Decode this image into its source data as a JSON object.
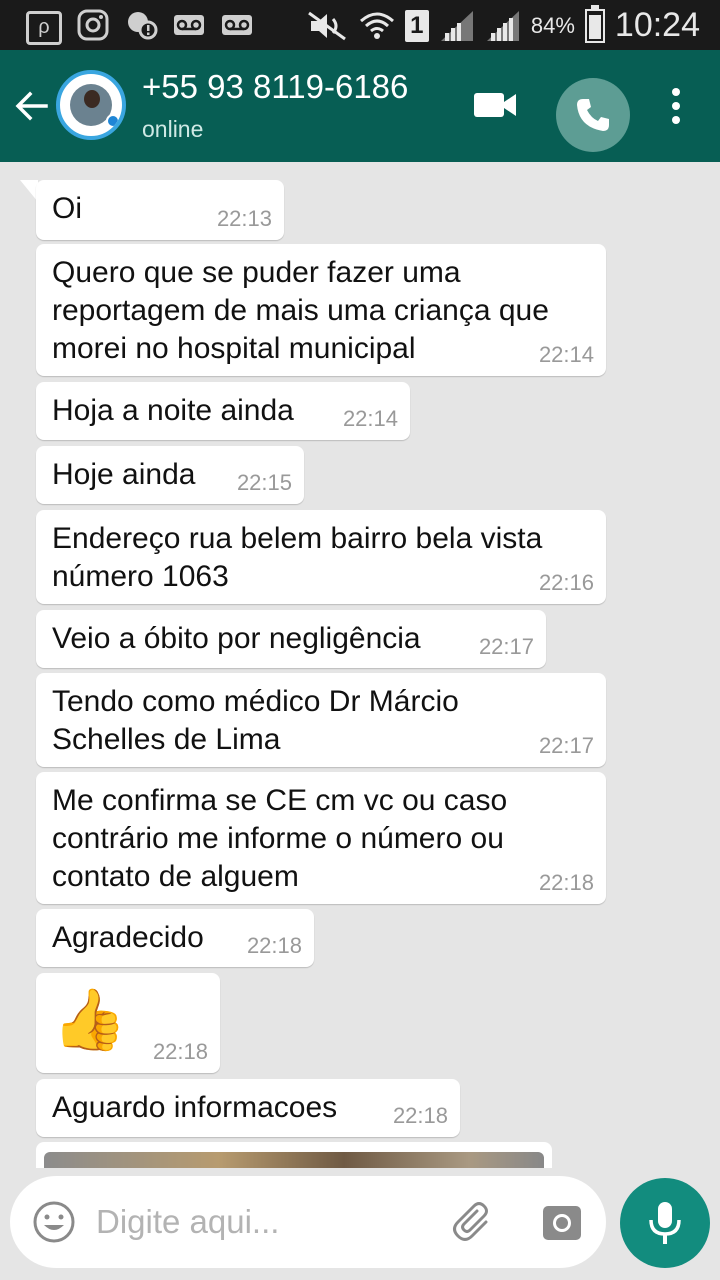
{
  "status_bar": {
    "battery": "84%",
    "time": "10:24",
    "sim_slot": "1",
    "left_icons": [
      "quick-app-icon",
      "instagram-icon",
      "notification-icon",
      "voicemail-icon",
      "voicemail-icon"
    ]
  },
  "header": {
    "contact_name": "+55 93 8119-6186",
    "status": "online",
    "color": "#075e54"
  },
  "messages": [
    {
      "text": "Oi",
      "time": "22:13"
    },
    {
      "text": "Quero que se puder fazer uma\nreportagem de mais uma criança que\nmorei no hospital municipal",
      "time": "22:14"
    },
    {
      "text": "Hoja a noite ainda",
      "time": "22:14"
    },
    {
      "text": "Hoje ainda",
      "time": "22:15"
    },
    {
      "text": "Endereço rua belem bairro bela vista\nnúmero 1063",
      "time": "22:16"
    },
    {
      "text": "Veio a óbito por negligência",
      "time": "22:17"
    },
    {
      "text": "Tendo como médico Dr Márcio\nSchelles de Lima",
      "time": "22:17"
    },
    {
      "text": "Me confirma se CE cm vc ou caso\ncontrário me informe o número ou\ncontato de alguem",
      "time": "22:18"
    },
    {
      "text": "Agradecido",
      "time": "22:18"
    },
    {
      "emoji": "👍",
      "time": "22:18"
    },
    {
      "text": "Aguardo informacoes",
      "time": "22:18"
    }
  ],
  "input": {
    "placeholder": "Digite aqui..."
  },
  "colors": {
    "accent": "#128c7e",
    "chat_background": "#e5e5e5",
    "bubble": "#ffffff"
  }
}
